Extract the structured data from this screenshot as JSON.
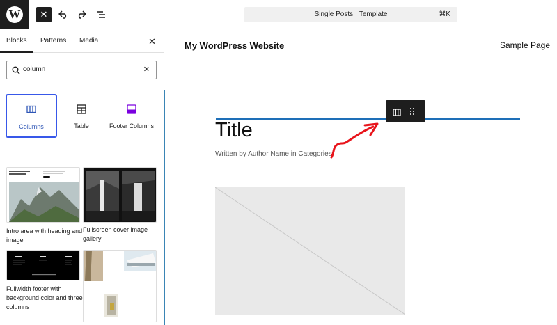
{
  "toolbar": {
    "logo_letter": "W",
    "close_label": "✕",
    "undo_icon": "undo-icon",
    "redo_icon": "redo-icon",
    "list_view_icon": "list-view-icon",
    "command_title": "Single Posts · Template",
    "command_shortcut": "⌘K"
  },
  "sidebar": {
    "tabs": [
      {
        "label": "Blocks",
        "active": true
      },
      {
        "label": "Patterns",
        "active": false
      },
      {
        "label": "Media",
        "active": false
      }
    ],
    "close_label": "✕",
    "search": {
      "value": "column",
      "placeholder": "Search"
    },
    "blocks": [
      {
        "label": "Columns",
        "icon": "columns-icon",
        "selected": true
      },
      {
        "label": "Table",
        "icon": "table-icon",
        "selected": false
      },
      {
        "label": "Footer Columns",
        "icon": "footer-columns-icon",
        "selected": false
      }
    ],
    "patterns": [
      {
        "label": "Intro area with heading and image"
      },
      {
        "label": "Fullscreen cover image gallery"
      },
      {
        "label": "Fullwidth footer with background color and three columns"
      },
      {
        "label": ""
      }
    ]
  },
  "canvas": {
    "site_title": "My WordPress Website",
    "nav_item": "Sample Page",
    "post_title": "Title",
    "byline_prefix": "Written by",
    "byline_author": "Author Name",
    "byline_suffix": "in Categories",
    "accent_color": "#1e6fb8",
    "annotation_color": "#e8141b"
  }
}
